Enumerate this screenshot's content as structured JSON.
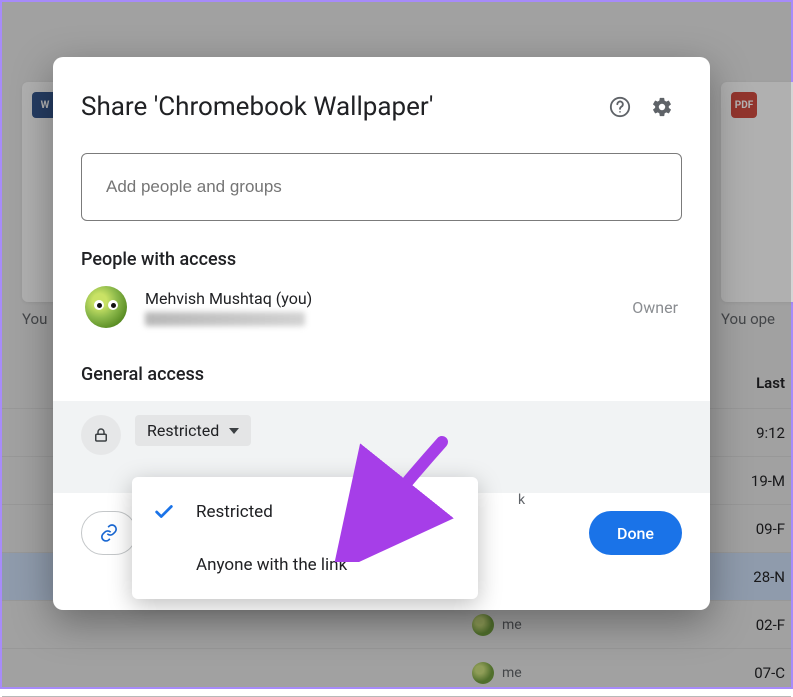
{
  "dialog": {
    "title": "Share 'Chromebook Wallpaper'",
    "add_placeholder": "Add people and groups",
    "section_people": "People with access",
    "section_general": "General access",
    "person": {
      "name": "Mehvish Mushtaq (you)",
      "role": "Owner"
    },
    "access_selected": "Restricted",
    "access_hint_tail": "k",
    "copy_link": "Copy link",
    "done": "Done"
  },
  "dropdown": {
    "opt_restricted": "Restricted",
    "opt_anyone": "Anyone with the link"
  },
  "background": {
    "you_label": "You",
    "you_open": "You ope",
    "last_header": "Last",
    "badge_w": "W",
    "badge_pdf": "PDF",
    "me_label": "me",
    "rows": [
      "9:12",
      "19-M",
      "09-F",
      "28-N",
      "02-F",
      "07-C"
    ]
  }
}
